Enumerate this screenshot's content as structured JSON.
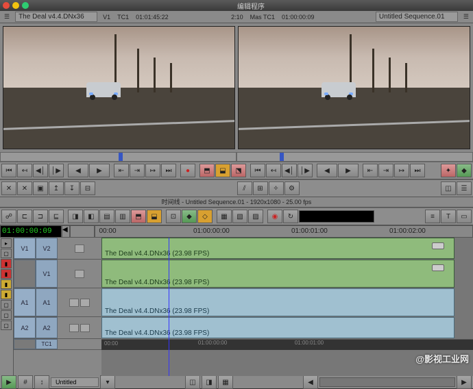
{
  "window": {
    "title": "编辑程序"
  },
  "seqbar": {
    "source_name": "The Deal v4.4.DNx36",
    "v1": "V1",
    "tc1_label": "TC1",
    "src_tc": "01:01:45:22",
    "dur": "2:10",
    "mask_label": "Mas TC1",
    "rec_tc": "01:00:00:09",
    "seq_name": "Untitled Sequence.01"
  },
  "timeline": {
    "title": "时间线 - Untitled Sequence.01 - 1920x1080 - 25.00 fps",
    "current_tc": "01:00:00:09",
    "ruler": [
      "00:00",
      "01:00:00:00",
      "01:00:01:00",
      "01:00:02:00"
    ],
    "playhead_pct": 18
  },
  "tracks": {
    "src": [
      "V1",
      "V1",
      "A1",
      "A2"
    ],
    "rec": [
      "V2",
      "V1",
      "A1",
      "A2"
    ],
    "tc": "TC1",
    "clip_label": "The Deal v4.4.DNx36 (23.98 FPS)"
  },
  "bottom": {
    "bin": "Untitled",
    "seq_dd": "▾"
  },
  "watermark": "@影视工业网"
}
